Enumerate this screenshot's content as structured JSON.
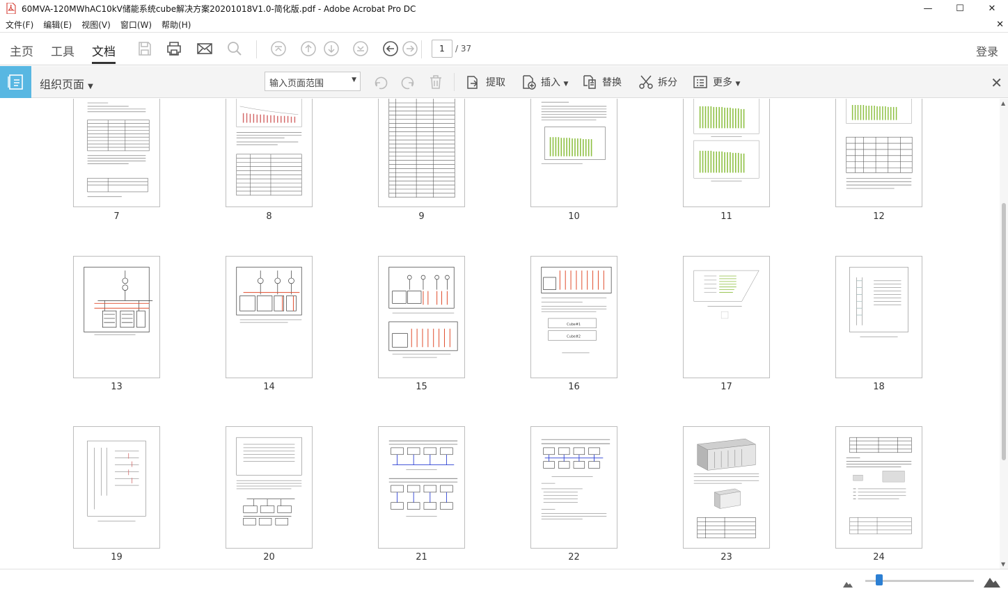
{
  "window": {
    "title": "60MVA-120MWhAC10kV储能系统cube解决方案20201018V1.0-简化版.pdf - Adobe Acrobat Pro DC",
    "controls": [
      "minimize-icon",
      "maximize-icon",
      "close-icon"
    ]
  },
  "menu": {
    "items": [
      "文件(F)",
      "编辑(E)",
      "视图(V)",
      "窗口(W)",
      "帮助(H)"
    ]
  },
  "nav": {
    "tabs": [
      "主页",
      "工具",
      "文档"
    ],
    "active_tab": "文档",
    "current_page": "1",
    "total_pages": "/ 37",
    "login": "登录"
  },
  "organize": {
    "title": "组织页面",
    "range_placeholder": "输入页面范围",
    "tools": [
      "提取",
      "插入",
      "替换",
      "拆分",
      "更多"
    ]
  },
  "pages": {
    "labels": [
      "7",
      "8",
      "9",
      "10",
      "11",
      "12",
      "13",
      "14",
      "15",
      "16",
      "17",
      "18",
      "19",
      "20",
      "21",
      "22",
      "23",
      "24"
    ]
  },
  "zoom": {
    "level": 0.13
  },
  "colors": {
    "accent": "#58b7e2",
    "slider": "#2c7fd3"
  }
}
